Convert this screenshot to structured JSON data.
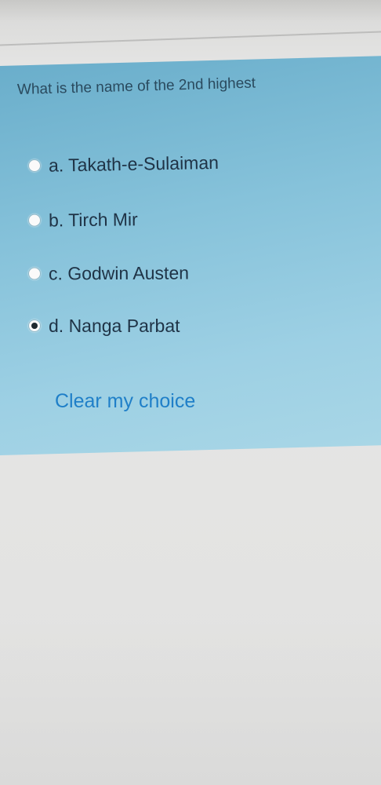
{
  "question": {
    "text": "What is the name of the 2nd highest"
  },
  "options": [
    {
      "label": "a. Takath-e-Sulaiman",
      "selected": false
    },
    {
      "label": "b. Tirch Mir",
      "selected": false
    },
    {
      "label": "c. Godwin Austen",
      "selected": false
    },
    {
      "label": "d. Nanga Parbat",
      "selected": true
    }
  ],
  "clear_choice": {
    "label": "Clear my choice"
  },
  "colors": {
    "panel_background": "#8cc6dc",
    "link": "#1f7fc8",
    "page_background": "#e6e6e5"
  }
}
